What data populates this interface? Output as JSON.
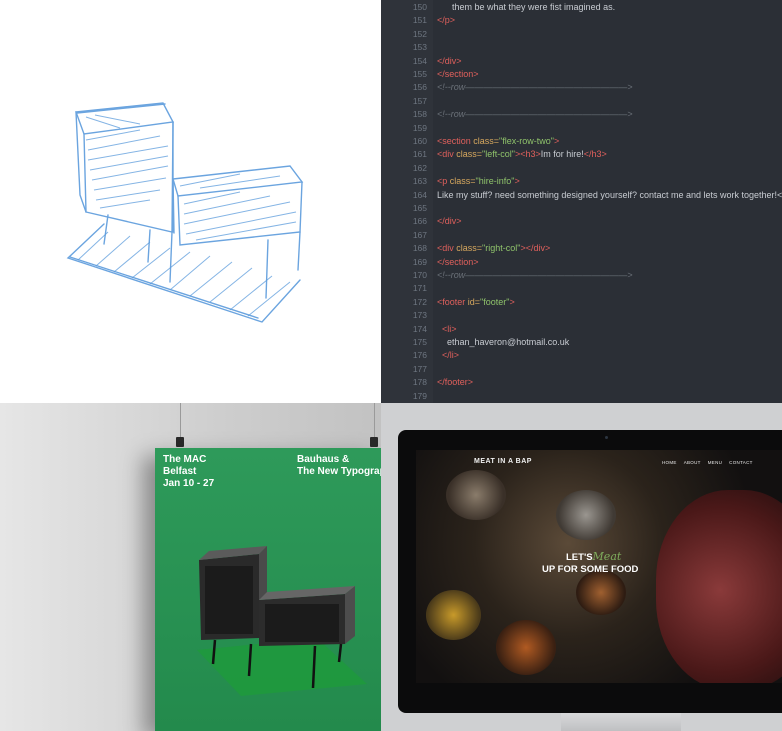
{
  "code_editor": {
    "lines": [
      {
        "num": "150",
        "segments": [
          {
            "t": "plain",
            "s": "      them be what they were fist imagined as."
          }
        ]
      },
      {
        "num": "151",
        "segments": [
          {
            "t": "tag",
            "s": "</p>"
          }
        ]
      },
      {
        "num": "152",
        "segments": []
      },
      {
        "num": "153",
        "segments": []
      },
      {
        "num": "154",
        "segments": [
          {
            "t": "tag",
            "s": "</div>"
          }
        ]
      },
      {
        "num": "155",
        "segments": [
          {
            "t": "tag",
            "s": "</section>"
          }
        ]
      },
      {
        "num": "156",
        "segments": [
          {
            "t": "com",
            "s": "<!--row——————————————————>"
          }
        ]
      },
      {
        "num": "157",
        "segments": []
      },
      {
        "num": "158",
        "segments": [
          {
            "t": "com",
            "s": "<!--row——————————————————>"
          }
        ]
      },
      {
        "num": "159",
        "segments": []
      },
      {
        "num": "160",
        "segments": [
          {
            "t": "tag",
            "s": "<section "
          },
          {
            "t": "attr",
            "s": "class="
          },
          {
            "t": "val",
            "s": "\"flex-row-two\""
          },
          {
            "t": "tag",
            "s": ">"
          }
        ]
      },
      {
        "num": "161",
        "segments": [
          {
            "t": "tag",
            "s": "<div "
          },
          {
            "t": "attr",
            "s": "class="
          },
          {
            "t": "val",
            "s": "\"left-col\""
          },
          {
            "t": "tag",
            "s": "><h3>"
          },
          {
            "t": "plain",
            "s": "Im for hire!"
          },
          {
            "t": "tag",
            "s": "</h3>"
          }
        ]
      },
      {
        "num": "162",
        "segments": []
      },
      {
        "num": "163",
        "segments": [
          {
            "t": "tag",
            "s": "<p "
          },
          {
            "t": "attr",
            "s": "class="
          },
          {
            "t": "val",
            "s": "\"hire-info\""
          },
          {
            "t": "tag",
            "s": ">"
          }
        ]
      },
      {
        "num": "164",
        "segments": [
          {
            "t": "plain",
            "s": "Like my stuff? need something designed yourself? contact me and lets work together!</p>"
          }
        ]
      },
      {
        "num": "165",
        "segments": []
      },
      {
        "num": "166",
        "segments": [
          {
            "t": "tag",
            "s": "</div>"
          }
        ]
      },
      {
        "num": "167",
        "segments": []
      },
      {
        "num": "168",
        "segments": [
          {
            "t": "tag",
            "s": "<div "
          },
          {
            "t": "attr",
            "s": "class="
          },
          {
            "t": "val",
            "s": "\"right-col\""
          },
          {
            "t": "tag",
            "s": "></div>"
          }
        ]
      },
      {
        "num": "169",
        "segments": [
          {
            "t": "tag",
            "s": "</section>"
          }
        ]
      },
      {
        "num": "170",
        "segments": [
          {
            "t": "com",
            "s": "<!--row——————————————————>"
          }
        ]
      },
      {
        "num": "171",
        "segments": []
      },
      {
        "num": "172",
        "segments": [
          {
            "t": "tag",
            "s": "<footer "
          },
          {
            "t": "attr",
            "s": "id="
          },
          {
            "t": "val",
            "s": "\"footer\""
          },
          {
            "t": "tag",
            "s": ">"
          }
        ]
      },
      {
        "num": "173",
        "segments": []
      },
      {
        "num": "174",
        "segments": [
          {
            "t": "plain",
            "s": "  "
          },
          {
            "t": "tag",
            "s": "<li>"
          }
        ]
      },
      {
        "num": "175",
        "segments": [
          {
            "t": "plain",
            "s": "    ethan_haveron@hotmail.co.uk"
          }
        ]
      },
      {
        "num": "176",
        "segments": [
          {
            "t": "plain",
            "s": "  "
          },
          {
            "t": "tag",
            "s": "</li>"
          }
        ]
      },
      {
        "num": "177",
        "segments": []
      },
      {
        "num": "178",
        "segments": [
          {
            "t": "tag",
            "s": "</footer>"
          }
        ]
      },
      {
        "num": "179",
        "segments": []
      }
    ],
    "colors": {
      "background": "#2b2f36",
      "tag": "#e0605c",
      "attr": "#d7a85e",
      "value": "#8fc36b",
      "comment": "#6a7078"
    }
  },
  "poster": {
    "left_lines": [
      "The MAC",
      "Belfast",
      "Jan 10 - 27"
    ],
    "right_lines": [
      "Bauhaus &",
      "The New Typograp"
    ],
    "background_color": "#2e9a5a"
  },
  "website": {
    "brand": "MEAT IN A BAP",
    "nav": [
      "HOME",
      "ABOUT",
      "MENU",
      "CONTACT"
    ],
    "hero_prefix": "LET'S",
    "hero_script": "Meat",
    "hero_line2": "UP FOR SOME FOOD",
    "accent_color": "#7fae5d"
  },
  "sketch": {
    "stroke_color": "#5b9bdc"
  }
}
